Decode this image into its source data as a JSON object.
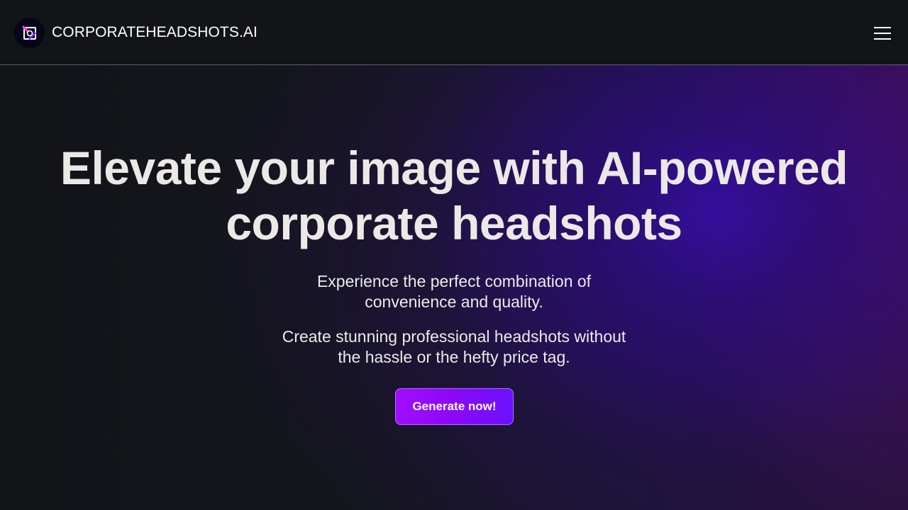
{
  "header": {
    "brand": "CORPORATEHEADSHOTS.AI",
    "logo_icon": "headshot-logo-icon",
    "menu_icon": "hamburger-menu-icon"
  },
  "hero": {
    "title_lines": [
      "Elevate your image with AI-powered",
      "corporate headshots"
    ],
    "subtitle1_lines": [
      "Experience the perfect combination of",
      "convenience and quality."
    ],
    "subtitle2_lines": [
      "Create stunning professional headshots without",
      "the hassle or the hefty price tag."
    ],
    "cta_label": "Generate now!"
  },
  "colors": {
    "background": "#111317",
    "accent_start": "#a20cff",
    "accent_end": "#6a12ff",
    "glow": "#2c0c80"
  }
}
